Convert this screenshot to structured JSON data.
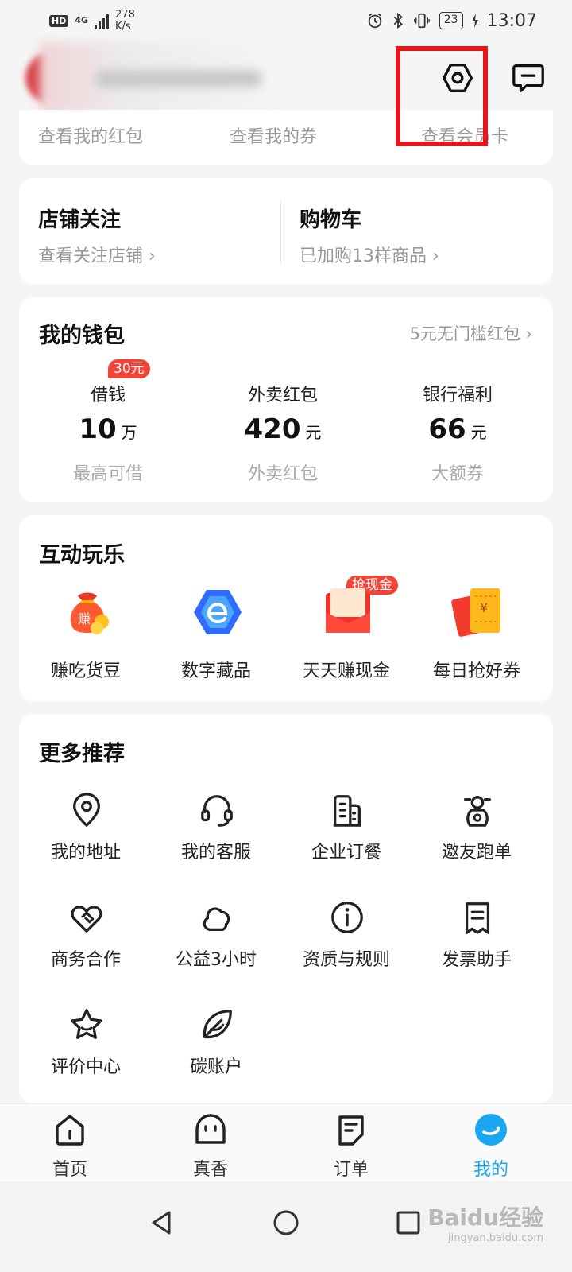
{
  "status_bar": {
    "hd": "HD",
    "network": "4G",
    "speed_value": "278",
    "speed_unit": "K/s",
    "battery": "23",
    "time": "13:07"
  },
  "header": {
    "settings_icon": "hexagon-gear-icon",
    "message_icon": "chat-bubble-icon"
  },
  "top_links": [
    "查看我的红包",
    "查看我的券",
    "查看会员卡"
  ],
  "follow": {
    "store": {
      "title": "店铺关注",
      "sub": "查看关注店铺",
      "arrow": "›"
    },
    "cart": {
      "title": "购物车",
      "sub": "已加购13样商品",
      "arrow": "›"
    }
  },
  "wallet": {
    "title": "我的钱包",
    "promo": "5元无门槛红包",
    "promo_arrow": "›",
    "items": [
      {
        "label": "借钱",
        "amount": "10",
        "unit": "万",
        "caption": "最高可借",
        "badge": "30元"
      },
      {
        "label": "外卖红包",
        "amount": "420",
        "unit": "元",
        "caption": "外卖红包"
      },
      {
        "label": "银行福利",
        "amount": "66",
        "unit": "元",
        "caption": "大额券"
      }
    ]
  },
  "fun": {
    "title": "互动玩乐",
    "items": [
      {
        "label": "赚吃货豆",
        "icon": "money-bag-icon"
      },
      {
        "label": "数字藏品",
        "icon": "digital-collectible-icon"
      },
      {
        "label": "天天赚现金",
        "icon": "red-envelope-icon",
        "badge": "抢现金"
      },
      {
        "label": "每日抢好券",
        "icon": "coupon-ticket-icon"
      }
    ]
  },
  "more": {
    "title": "更多推荐",
    "items": [
      {
        "label": "我的地址",
        "icon": "location-pin-icon"
      },
      {
        "label": "我的客服",
        "icon": "headset-icon"
      },
      {
        "label": "企业订餐",
        "icon": "building-icon"
      },
      {
        "label": "邀友跑单",
        "icon": "scooter-icon"
      },
      {
        "label": "商务合作",
        "icon": "handshake-icon"
      },
      {
        "label": "公益3小时",
        "icon": "cloud-icon"
      },
      {
        "label": "资质与规则",
        "icon": "info-icon"
      },
      {
        "label": "发票助手",
        "icon": "receipt-icon"
      },
      {
        "label": "评价中心",
        "icon": "star-icon"
      },
      {
        "label": "碳账户",
        "icon": "leaf-icon"
      }
    ]
  },
  "tabs": [
    {
      "label": "首页",
      "icon": "home-icon",
      "active": false
    },
    {
      "label": "真香",
      "icon": "smile-face-icon",
      "active": false
    },
    {
      "label": "订单",
      "icon": "order-doc-icon",
      "active": false
    },
    {
      "label": "我的",
      "icon": "profile-face-icon",
      "active": true
    }
  ],
  "watermark": {
    "brand": "Baidu经验",
    "url": "jingyan.baidu.com"
  },
  "colors": {
    "accent": "#1aa7f0",
    "badge_red": "#f04438",
    "highlight_red": "#e8141c"
  }
}
